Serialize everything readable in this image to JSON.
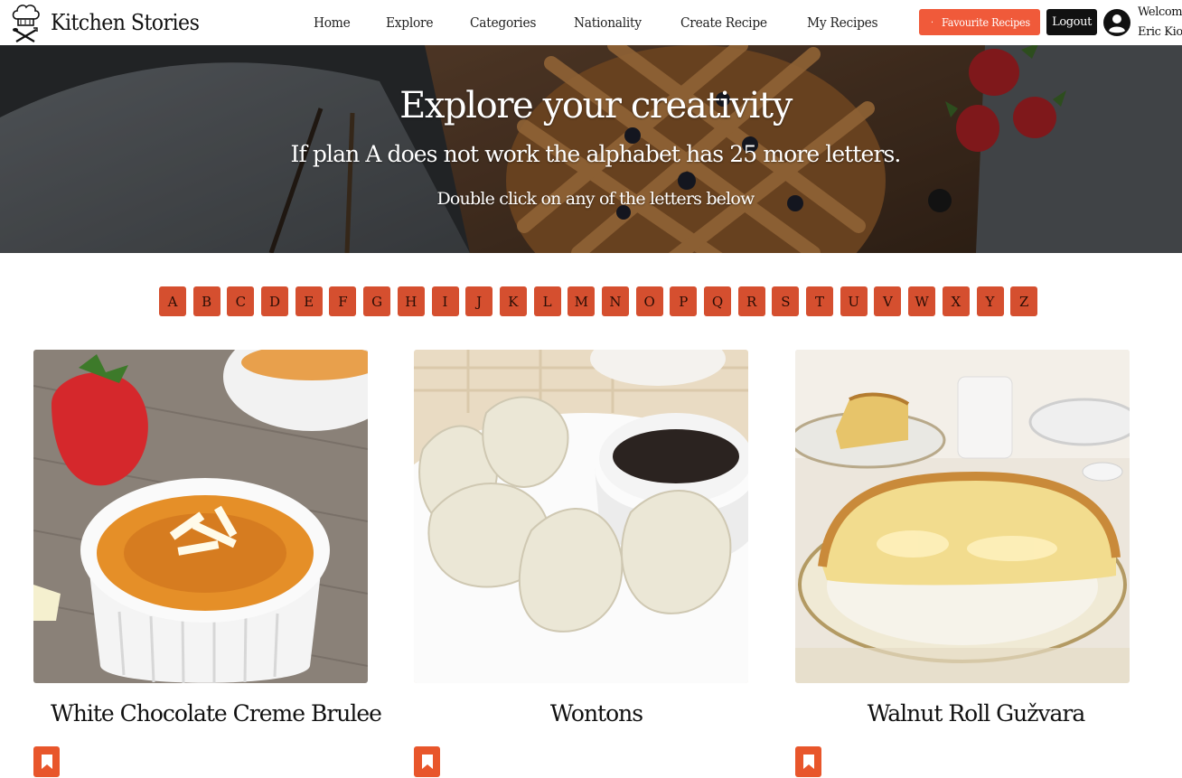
{
  "brand": {
    "name": "Kitchen Stories",
    "logo_icon": "chef-hat-utensils-icon"
  },
  "nav": {
    "links": [
      "Home",
      "Explore",
      "Categories",
      "Nationality",
      "Create Recipe",
      "My Recipes"
    ]
  },
  "header_actions": {
    "favourites_label": "Favourite Recipes",
    "favourites_icon": "bookmark-icon",
    "logout_label": "Logout",
    "user_icon": "user-circle-icon",
    "welcome_line1": "Welcome",
    "welcome_line2": "Eric Kiok"
  },
  "hero": {
    "title": "Explore your creativity",
    "subtitle": "If plan A does not work the alphabet has 25 more letters.",
    "hint": "Double click on any of the letters below"
  },
  "alphabet": [
    "A",
    "B",
    "C",
    "D",
    "E",
    "F",
    "G",
    "H",
    "I",
    "J",
    "K",
    "L",
    "M",
    "N",
    "O",
    "P",
    "Q",
    "R",
    "S",
    "T",
    "U",
    "V",
    "W",
    "X",
    "Y",
    "Z"
  ],
  "recipes": [
    {
      "title": "White Chocolate Creme Brulee",
      "image": "creme-brulee-photo"
    },
    {
      "title": "Wontons",
      "image": "wontons-photo"
    },
    {
      "title": "Walnut Roll Gužvara",
      "image": "walnut-roll-photo"
    }
  ],
  "colors": {
    "accent": "#f05a3a",
    "letter_bg": "#d54f2f",
    "bookmark_bg": "#e8562b",
    "logout_bg": "#111111"
  }
}
